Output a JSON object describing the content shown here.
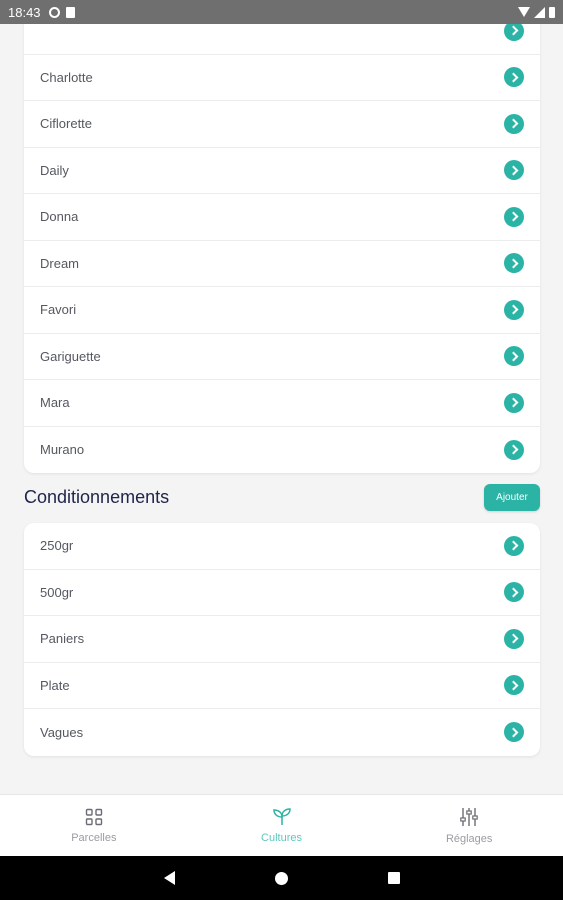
{
  "status_bar": {
    "time": "18:43"
  },
  "varieties": [
    "",
    "Charlotte",
    "Ciflorette",
    "Daily",
    "Donna",
    "Dream",
    "Favori",
    "Gariguette",
    "Mara",
    "Murano"
  ],
  "conditionnements": {
    "title": "Conditionnements",
    "add_label": "Ajouter",
    "items": [
      "250gr",
      "500gr",
      "Paniers",
      "Plate",
      "Vagues"
    ]
  },
  "bottom_nav": {
    "items": [
      {
        "label": "Parcelles",
        "icon": "grid-icon"
      },
      {
        "label": "Cultures",
        "icon": "sprout-icon",
        "active": true
      },
      {
        "label": "Réglages",
        "icon": "sliders-icon"
      }
    ]
  },
  "colors": {
    "accent": "#2bb3a5",
    "title": "#20264a",
    "nav_active": "#5fc8bd"
  }
}
